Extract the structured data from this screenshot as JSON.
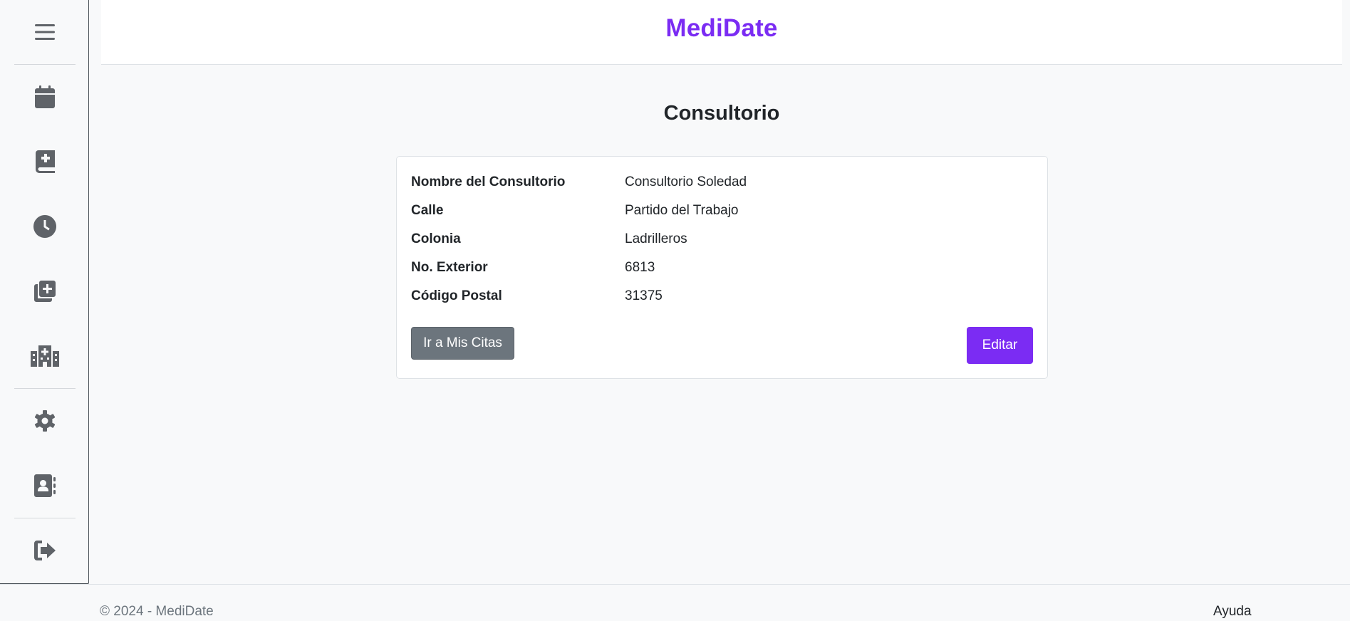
{
  "app": {
    "brand": "MediDate"
  },
  "sidebar": {
    "items": [
      {
        "icon": "menu-icon"
      },
      {
        "icon": "calendar-icon"
      },
      {
        "icon": "medical-book-icon"
      },
      {
        "icon": "clock-icon"
      },
      {
        "icon": "add-copies-icon"
      },
      {
        "icon": "hospital-icon"
      },
      {
        "icon": "gear-icon"
      },
      {
        "icon": "contact-book-icon"
      },
      {
        "icon": "logout-icon"
      }
    ]
  },
  "main": {
    "title": "Consultorio",
    "details": [
      {
        "label": "Nombre del Consultorio",
        "value": "Consultorio Soledad"
      },
      {
        "label": "Calle",
        "value": "Partido del Trabajo"
      },
      {
        "label": "Colonia",
        "value": "Ladrilleros"
      },
      {
        "label": "No. Exterior",
        "value": "6813"
      },
      {
        "label": "Código Postal",
        "value": "31375"
      }
    ],
    "buttons": {
      "go_to_appointments": "Ir a Mis Citas",
      "edit": "Editar"
    }
  },
  "footer": {
    "copyright": "© 2024 - MediDate",
    "help": "Ayuda"
  },
  "colors": {
    "brand": "#7b2cf3",
    "secondary_button": "#6c757d",
    "icon": "#5f6368"
  }
}
